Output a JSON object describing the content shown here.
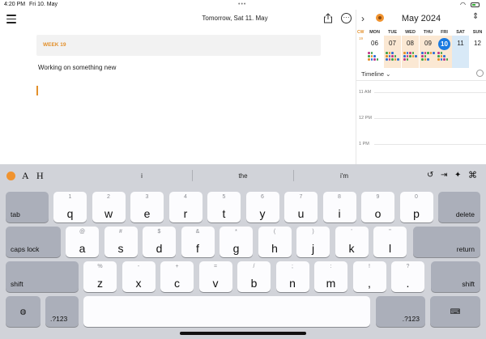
{
  "status": {
    "time": "4:20 PM",
    "date": "Fri 10. May"
  },
  "header": {
    "title": "Tomorrow, Sat 11. May"
  },
  "editor": {
    "week_label": "WEEK 19",
    "note": "Working on something new"
  },
  "calendar": {
    "month": "May 2024",
    "cw_label": "CW",
    "week_number": "19",
    "day_headers": [
      "MON",
      "TUE",
      "WED",
      "THU",
      "FRI",
      "SAT",
      "SUN"
    ],
    "dates": [
      "06",
      "07",
      "08",
      "09",
      "10",
      "11",
      "12"
    ],
    "today_index": 4,
    "view_label": "Timeline",
    "time_labels": [
      "11 AM",
      "12 PM",
      "1 PM"
    ],
    "colors": {
      "week_bg": "#fbe8d3",
      "selected_bg": "#d8e9f7",
      "today": "#1a7ae0",
      "accent": "#e3902b"
    }
  },
  "keyboard": {
    "suggestions": [
      "i",
      "the",
      "i'm"
    ],
    "row1": {
      "tab": "tab",
      "delete": "delete",
      "keys": [
        {
          "alt": "1",
          "main": "q"
        },
        {
          "alt": "2",
          "main": "w"
        },
        {
          "alt": "3",
          "main": "e"
        },
        {
          "alt": "4",
          "main": "r"
        },
        {
          "alt": "5",
          "main": "t"
        },
        {
          "alt": "6",
          "main": "y"
        },
        {
          "alt": "7",
          "main": "u"
        },
        {
          "alt": "8",
          "main": "i"
        },
        {
          "alt": "9",
          "main": "o"
        },
        {
          "alt": "0",
          "main": "p"
        }
      ]
    },
    "row2": {
      "caps": "caps lock",
      "return": "return",
      "keys": [
        {
          "alt": "@",
          "main": "a"
        },
        {
          "alt": "#",
          "main": "s"
        },
        {
          "alt": "$",
          "main": "d"
        },
        {
          "alt": "&",
          "main": "f"
        },
        {
          "alt": "*",
          "main": "g"
        },
        {
          "alt": "(",
          "main": "h"
        },
        {
          "alt": ")",
          "main": "j"
        },
        {
          "alt": "'",
          "main": "k"
        },
        {
          "alt": "\"",
          "main": "l"
        }
      ]
    },
    "row3": {
      "shift_left": "shift",
      "shift_right": "shift",
      "keys": [
        {
          "alt": "%",
          "main": "z"
        },
        {
          "alt": "-",
          "main": "x"
        },
        {
          "alt": "+",
          "main": "c"
        },
        {
          "alt": "=",
          "main": "v"
        },
        {
          "alt": "/",
          "main": "b"
        },
        {
          "alt": ";",
          "main": "n"
        },
        {
          "alt": ":",
          "main": "m"
        },
        {
          "alt": "!",
          "main": ","
        },
        {
          "alt": "?",
          "main": "."
        }
      ]
    },
    "row4": {
      "numbers_left": ".?123",
      "numbers_right": ".?123"
    }
  }
}
